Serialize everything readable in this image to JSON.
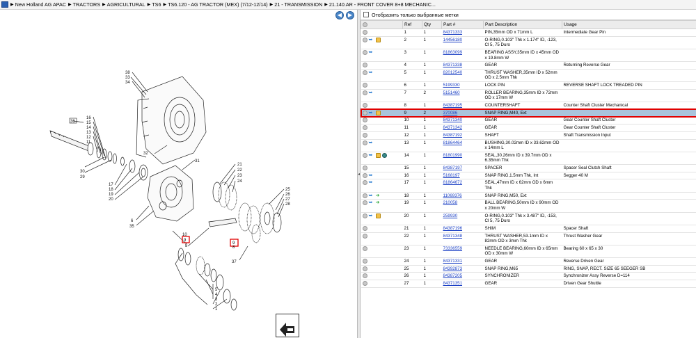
{
  "breadcrumb": [
    "New Holland AG APAC",
    "TRACTORS",
    "AGRICULTURAL",
    "TS6",
    "TS6.120 - AG TRACTOR (MEX) (7/12-12/14)",
    "21 - TRANSMISSION",
    "21.140.AR - FRONT COVER 8+8 MECHANIC..."
  ],
  "filter_label": "Отобразить только выбранные метки",
  "columns": {
    "ref": "Ref",
    "qty": "Qty",
    "part": "Part #",
    "desc": "Part Description",
    "usage": "Usage"
  },
  "rows": [
    {
      "icons": [],
      "ref": "1",
      "qty": "1",
      "part": "84371333",
      "desc": "PIN,35mm OD x 71mm L",
      "usage": "Intermediate Gear Pin"
    },
    {
      "icons": [
        "note",
        "kit"
      ],
      "ref": "2",
      "qty": "1",
      "part": "14456180",
      "desc": "O-RING,0.103\" Thk x 1.174\" ID, -123, Cl 5, 75 Duro",
      "usage": ""
    },
    {
      "icons": [
        "note"
      ],
      "ref": "3",
      "qty": "1",
      "part": "81863099",
      "desc": "BEARING ASSY,35mm ID x 45mm OD x 19.8mm W",
      "usage": ""
    },
    {
      "icons": [],
      "ref": "4",
      "qty": "1",
      "part": "84371338",
      "desc": "GEAR",
      "usage": "Returning Reverse Gear"
    },
    {
      "icons": [
        "note"
      ],
      "ref": "5",
      "qty": "1",
      "part": "82012540",
      "desc": "THRUST WASHER,35mm ID x 52mm OD x 2.5mm Thk",
      "usage": ""
    },
    {
      "icons": [],
      "ref": "6",
      "qty": "1",
      "part": "5199330",
      "desc": "LOCK PIN",
      "usage": "REVERSE SHAFT LOCK TREADED PIN"
    },
    {
      "icons": [
        "note"
      ],
      "ref": "7",
      "qty": "2",
      "part": "5151460",
      "desc": "ROLLER BEARING,35mm ID x 72mm OD x 17mm W",
      "usage": ""
    },
    {
      "icons": [],
      "ref": "8",
      "qty": "1",
      "part": "84387195",
      "desc": "COUNTERSHAFT",
      "usage": "Counter Shaft Cluster Mechanical"
    },
    {
      "icons": [
        "note",
        "kit"
      ],
      "ref": "9",
      "qty": "2",
      "part": "370086",
      "desc": "SNAP RING,M40, Ext",
      "usage": "",
      "selected": true
    },
    {
      "icons": [],
      "ref": "10",
      "qty": "1",
      "part": "84371340",
      "desc": "GEAR",
      "usage": "Gear Counter Shaft Cluster"
    },
    {
      "icons": [],
      "ref": "11",
      "qty": "1",
      "part": "84371342",
      "desc": "GEAR",
      "usage": "Gear Counter Shaft Cluster"
    },
    {
      "icons": [],
      "ref": "12",
      "qty": "1",
      "part": "84387192",
      "desc": "SHAFT",
      "usage": "Shaft Transmission Input"
    },
    {
      "icons": [
        "note"
      ],
      "ref": "13",
      "qty": "1",
      "part": "81864464",
      "desc": "BUSHING,30.02mm ID x 33.62mm OD x 14mm L",
      "usage": ""
    },
    {
      "icons": [
        "note",
        "kit",
        "globe"
      ],
      "ref": "14",
      "qty": "1",
      "part": "81801990",
      "desc": "SEAL,30.26mm ID x 39.7mm OD x 6.35mm Thk",
      "usage": ""
    },
    {
      "icons": [],
      "ref": "15",
      "qty": "1",
      "part": "84387197",
      "desc": "SPACER",
      "usage": "Spacer Seal Clutch Shaft"
    },
    {
      "icons": [
        "note"
      ],
      "ref": "16",
      "qty": "1",
      "part": "5168197",
      "desc": "SNAP RING,1.5mm Thk, Int",
      "usage": "Segger 40 M"
    },
    {
      "icons": [
        "note"
      ],
      "ref": "17",
      "qty": "1",
      "part": "81864672",
      "desc": "SEAL,47mm ID x 62mm OD x 6mm Thk",
      "usage": ""
    },
    {
      "icons": [
        "note",
        "arrow"
      ],
      "ref": "18",
      "qty": "1",
      "part": "11069376",
      "desc": "SNAP RING,M50, Ext",
      "usage": ""
    },
    {
      "icons": [
        "note",
        "arrow"
      ],
      "ref": "19",
      "qty": "1",
      "part": "210058",
      "desc": "BALL BEARING,50mm ID x 90mm OD x 20mm W",
      "usage": ""
    },
    {
      "icons": [
        "note",
        "kit"
      ],
      "ref": "20",
      "qty": "1",
      "part": "259930",
      "desc": "O-RING,0.103\" Thk x 3.487\" ID, -153, Cl 5, 75 Duro",
      "usage": ""
    },
    {
      "icons": [],
      "ref": "21",
      "qty": "1",
      "part": "84387196",
      "desc": "SHIM",
      "usage": "Spacer Shaft"
    },
    {
      "icons": [],
      "ref": "22",
      "qty": "1",
      "part": "84371348",
      "desc": "THRUST WASHER,53.1mm ID x 82mm OD x 3mm Thk",
      "usage": "Thrust Washer Gear"
    },
    {
      "icons": [],
      "ref": "23",
      "qty": "1",
      "part": "73336559",
      "desc": "NEEDLE BEARING,60mm ID x 65mm OD x 30mm W",
      "usage": "Bearing 60 x 65 x 30"
    },
    {
      "icons": [],
      "ref": "24",
      "qty": "1",
      "part": "84371331",
      "desc": "GEAR",
      "usage": "Reverse Driven Gear"
    },
    {
      "icons": [],
      "ref": "25",
      "qty": "1",
      "part": "84392873",
      "desc": "SNAP RING,M65",
      "usage": "RING, SNAP, RECT. SIZE 65 SEEGER SB"
    },
    {
      "icons": [],
      "ref": "26",
      "qty": "1",
      "part": "84387205",
      "desc": "SYNCHRONIZER",
      "usage": "Synchronizer Assy Reverse D=114"
    },
    {
      "icons": [],
      "ref": "27",
      "qty": "1",
      "part": "84371351",
      "desc": "GEAR",
      "usage": "Driven Gear Shuttle"
    }
  ],
  "drawing": {
    "callouts": [
      "38",
      "33",
      "34",
      "36",
      "16",
      "15",
      "14",
      "13",
      "12",
      "11",
      "32",
      "30",
      "29",
      "17",
      "18",
      "19",
      "20",
      "31",
      "21",
      "22",
      "23",
      "24",
      "25",
      "26",
      "27",
      "28",
      "6",
      "35",
      "10",
      "9",
      "8",
      "37",
      "5",
      "4",
      "3",
      "2",
      "1",
      "8",
      "9"
    ],
    "highlight_refs": [
      "9",
      "9"
    ]
  },
  "colors": {
    "accent": "#2a5fb0",
    "selected": "#a9c4dc",
    "highlight": "#e00000",
    "link": "#1a3fc4"
  }
}
